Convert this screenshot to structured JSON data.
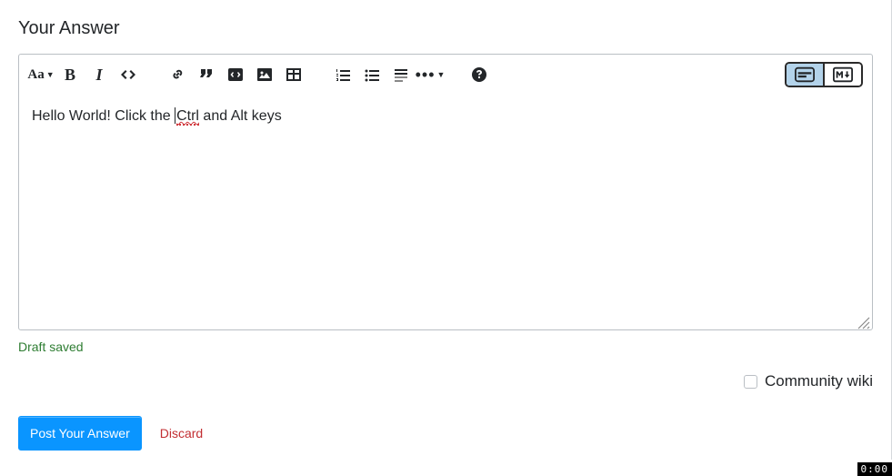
{
  "title": "Your Answer",
  "editor": {
    "content_pre": "Hello World! Click the ",
    "content_spellcheck": "Ctrl",
    "content_post": " and Alt keys"
  },
  "draft_status": "Draft saved",
  "wiki": {
    "label": "Community wiki",
    "checked": false
  },
  "actions": {
    "post": "Post Your Answer",
    "discard": "Discard"
  },
  "timer": "0:00",
  "toolbar": {
    "heading": "Aa",
    "bold": "B",
    "italic": "I",
    "more": "•••"
  }
}
